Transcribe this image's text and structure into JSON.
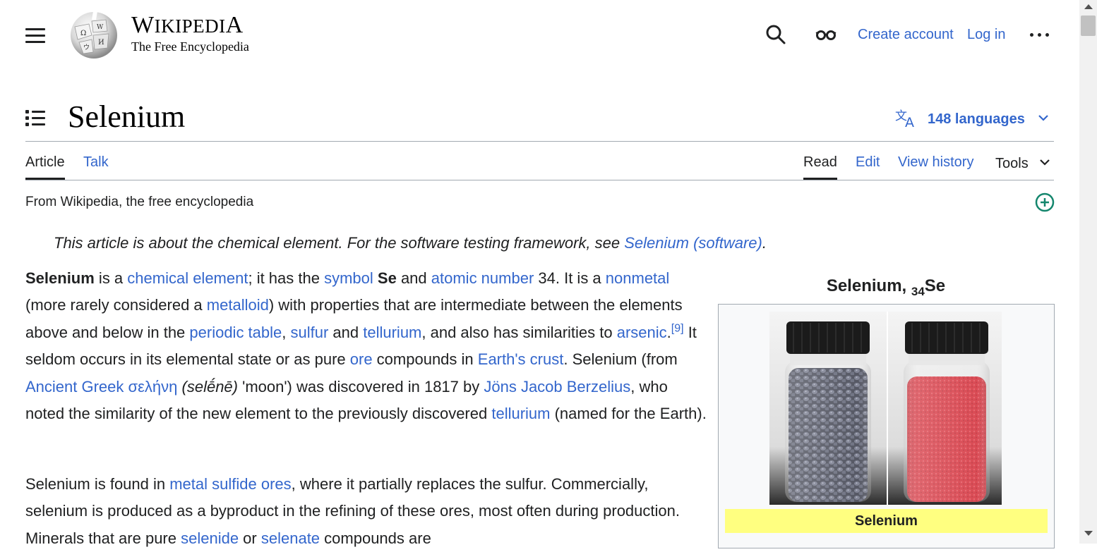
{
  "header": {
    "logo_title": "Wikipedia",
    "logo_title_w": "W",
    "logo_title_iki": "IKIPEDI",
    "logo_title_a": "A",
    "logo_tagline": "The Free Encyclopedia",
    "create_account": "Create account",
    "log_in": "Log in"
  },
  "page": {
    "title": "Selenium",
    "languages": "148 languages",
    "tabs_left": [
      "Article",
      "Talk"
    ],
    "tabs_right": [
      "Read",
      "Edit",
      "View history",
      "Tools"
    ],
    "from": "From Wikipedia, the free encyclopedia",
    "hatnote": {
      "text": "This article is about the chemical element. For the software testing framework, see ",
      "link": "Selenium (software)",
      "end": "."
    },
    "para1": [
      {
        "t": "Selenium",
        "b": true
      },
      {
        "t": " is a "
      },
      {
        "t": "chemical element",
        "l": true
      },
      {
        "t": "; it has the "
      },
      {
        "t": "symbol",
        "l": true
      },
      {
        "t": " "
      },
      {
        "t": "Se",
        "b": true
      },
      {
        "t": " and "
      },
      {
        "t": "atomic number",
        "l": true
      },
      {
        "t": " 34. It is a "
      },
      {
        "t": "nonmetal",
        "l": true
      },
      {
        "t": " (more rarely considered a "
      },
      {
        "t": "metalloid",
        "l": true
      },
      {
        "t": ") with properties that are intermediate between the elements above and below in the "
      },
      {
        "t": "periodic table",
        "l": true
      },
      {
        "t": ", "
      },
      {
        "t": "sulfur",
        "l": true
      },
      {
        "t": " and "
      },
      {
        "t": "tellurium",
        "l": true
      },
      {
        "t": ", and also has similarities to "
      },
      {
        "t": "arsenic",
        "l": true
      },
      {
        "t": "."
      },
      {
        "t": "[9]",
        "l": true,
        "sup": true
      },
      {
        "t": " It seldom occurs in its elemental state or as pure "
      },
      {
        "t": "ore",
        "l": true
      },
      {
        "t": " compounds in "
      },
      {
        "t": "Earth's crust",
        "l": true
      },
      {
        "t": ". Selenium (from "
      },
      {
        "t": "Ancient Greek",
        "l": true
      },
      {
        "t": " "
      },
      {
        "t": "σελήνη",
        "l": true
      },
      {
        "t": " "
      },
      {
        "t": "(selḗnē)",
        "i": true
      },
      {
        "t": " 'moon') was discovered in 1817 by "
      },
      {
        "t": "Jöns Jacob Berzelius",
        "l": true
      },
      {
        "t": ", who noted the similarity of the new element to the previously discovered "
      },
      {
        "t": "tellurium",
        "l": true
      },
      {
        "t": " (named for the Earth)."
      }
    ],
    "para2": [
      {
        "t": "Selenium is found in "
      },
      {
        "t": "metal sulfide ores",
        "l": true
      },
      {
        "t": ", where it partially replaces the sulfur. Commercially, selenium is produced as a byproduct in the refining of these ores, most often during production. Minerals that are pure "
      },
      {
        "t": "selenide",
        "l": true
      },
      {
        "t": " or "
      },
      {
        "t": "selenate",
        "l": true
      },
      {
        "t": " compounds are"
      }
    ]
  },
  "infobox": {
    "title": "Selenium, ",
    "title_sub": "34",
    "title_end": "Se",
    "caption": "Selenium"
  },
  "colors": {
    "link": "#3366cc",
    "text": "#202122",
    "caption_bg": "#ffff80",
    "border": "#a2a9b1"
  },
  "icons": [
    "menu-icon",
    "wikipedia-globe-logo",
    "search-icon",
    "glasses-icon",
    "more-icon",
    "toc-icon",
    "language-icon",
    "chevron-down-icon",
    "add-topic-icon"
  ]
}
